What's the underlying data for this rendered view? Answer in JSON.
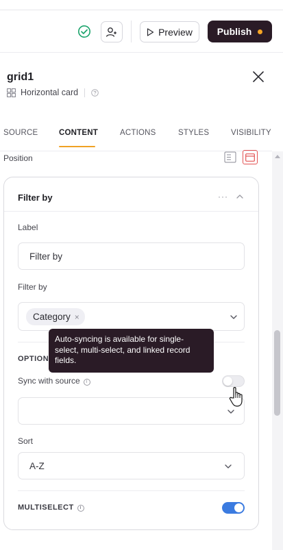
{
  "header": {
    "preview_label": "Preview",
    "publish_label": "Publish",
    "publish_dot_color": "#f5a524",
    "icons": [
      "check-circle-icon",
      "add-user-icon",
      "play-icon"
    ]
  },
  "component": {
    "name": "grid1",
    "type": "Horizontal card"
  },
  "tabs": [
    {
      "label": "SOURCE",
      "active": false
    },
    {
      "label": "CONTENT",
      "active": true
    },
    {
      "label": "ACTIONS",
      "active": false
    },
    {
      "label": "STYLES",
      "active": false
    },
    {
      "label": "VISIBILITY",
      "active": false
    }
  ],
  "position_label": "Position",
  "card": {
    "title": "Filter by",
    "more_label": "···",
    "label_field": {
      "label": "Label",
      "value": "Filter by"
    },
    "filter_field": {
      "label": "Filter by",
      "chip": "Category",
      "chip_remove": "×"
    },
    "options_title": "OPTIONS",
    "sync": {
      "label": "Sync with source",
      "enabled": false
    },
    "sync_select_value": "",
    "sort": {
      "label": "Sort",
      "value": "A-Z"
    },
    "multiselect": {
      "label": "MULTISELECT",
      "enabled": true
    }
  },
  "tooltip": "Auto-syncing is available for single-select, multi-select, and linked record fields.",
  "colors": {
    "accent": "#f0a224",
    "publish_bg": "#2a1b26",
    "toggle_on": "#3b7be0",
    "check_green": "#1aa36b"
  }
}
